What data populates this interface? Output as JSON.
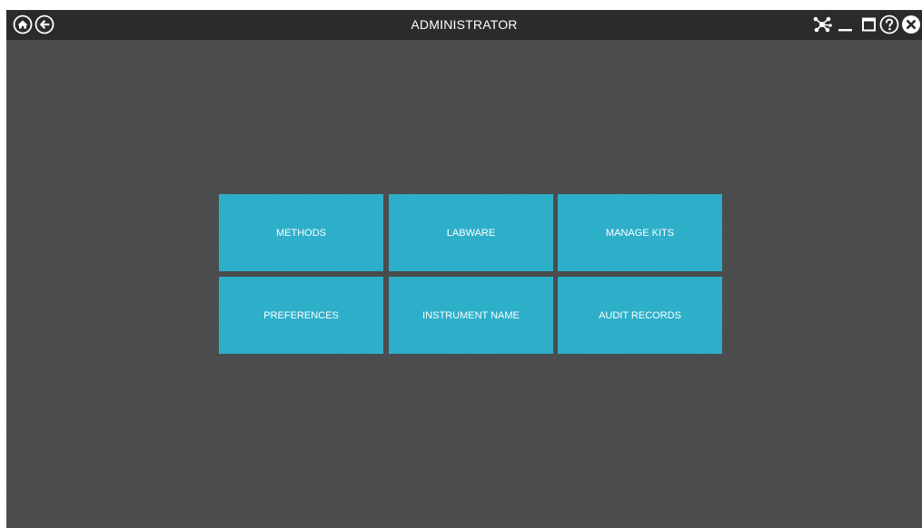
{
  "window": {
    "title": "ADMINISTRATOR"
  },
  "titlebar": {
    "left_icons": [
      "home-icon",
      "back-icon"
    ],
    "right_icons": [
      "network-icon",
      "minimize-icon",
      "restore-icon",
      "help-icon",
      "close-icon"
    ]
  },
  "tiles": [
    {
      "label": "METHODS"
    },
    {
      "label": "LABWARE"
    },
    {
      "label": "MANAGE KITS"
    },
    {
      "label": "PREFERENCES"
    },
    {
      "label": "INSTRUMENT NAME"
    },
    {
      "label": "AUDIT RECORDS"
    }
  ],
  "colors": {
    "titlebar": "#2b2b2c",
    "background": "#4a4b4d",
    "tile": "#2eafc9",
    "text": "#ffffff"
  }
}
